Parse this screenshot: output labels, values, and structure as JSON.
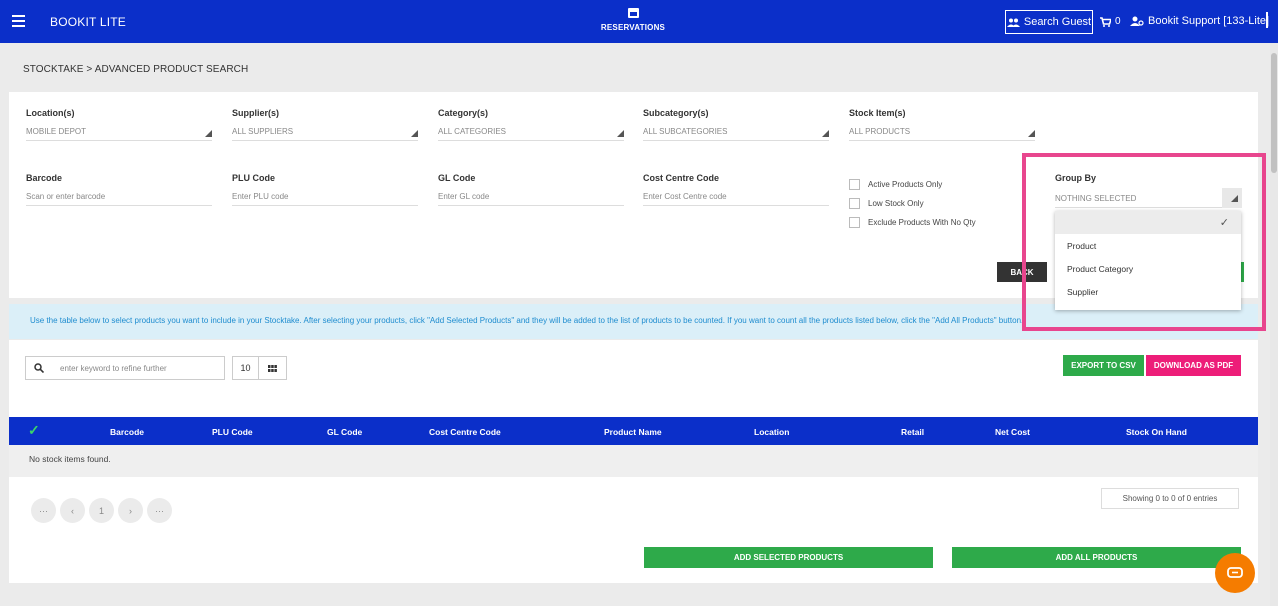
{
  "app": {
    "brand": "BOOKIT LITE"
  },
  "nav": {
    "reservations": "RESERVATIONS",
    "search_guest": "Search Guest",
    "cart_count": "0",
    "user": "Bookit Support [133-Lite]"
  },
  "breadcrumb": "STOCKTAKE > ADVANCED PRODUCT SEARCH",
  "filters": {
    "location": {
      "label": "Location(s)",
      "value": "MOBILE DEPOT"
    },
    "supplier": {
      "label": "Supplier(s)",
      "value": "ALL SUPPLIERS"
    },
    "category": {
      "label": "Category(s)",
      "value": "ALL CATEGORIES"
    },
    "subcategory": {
      "label": "Subcategory(s)",
      "value": "ALL SUBCATEGORIES"
    },
    "stock_item": {
      "label": "Stock Item(s)",
      "value": "ALL PRODUCTS"
    },
    "barcode": {
      "label": "Barcode",
      "placeholder": "Scan or enter barcode"
    },
    "plu": {
      "label": "PLU Code",
      "placeholder": "Enter PLU code"
    },
    "gl": {
      "label": "GL Code",
      "placeholder": "Enter GL code"
    },
    "cost_centre": {
      "label": "Cost Centre Code",
      "placeholder": "Enter Cost Centre code"
    },
    "checkboxes": [
      "Active Products Only",
      "Low Stock Only",
      "Exclude Products With No Qty"
    ],
    "back": "BACK"
  },
  "group_by": {
    "label": "Group By",
    "value": "NOTHING SELECTED",
    "options": [
      "",
      "Product",
      "Product Category",
      "Supplier"
    ]
  },
  "info": "Use the table below to select products you want to include in your Stocktake. After selecting your products, click \"Add Selected Products\" and they will be added to the list of products to be counted. If you want to count all the products listed below, click the \"Add All Products\" button.",
  "table": {
    "search_placeholder": "enter keyword to refine further",
    "page_size": "10",
    "export_csv": "EXPORT TO CSV",
    "download_pdf": "DOWNLOAD AS PDF",
    "columns": [
      "Barcode",
      "PLU Code",
      "GL Code",
      "Cost Centre Code",
      "Product Name",
      "Location",
      "Retail",
      "Net Cost",
      "Stock On Hand"
    ],
    "empty": "No stock items found.",
    "pager": [
      "···",
      "‹",
      "1",
      "›",
      "···"
    ],
    "showing": "Showing 0 to 0 of 0 entries",
    "add_selected": "ADD SELECTED PRODUCTS",
    "add_all": "ADD ALL PRODUCTS"
  },
  "colors": {
    "nav": "#0b2fc9",
    "green": "#2eaa4a",
    "pink": "#ed1e79",
    "highlight": "#e8468e"
  }
}
